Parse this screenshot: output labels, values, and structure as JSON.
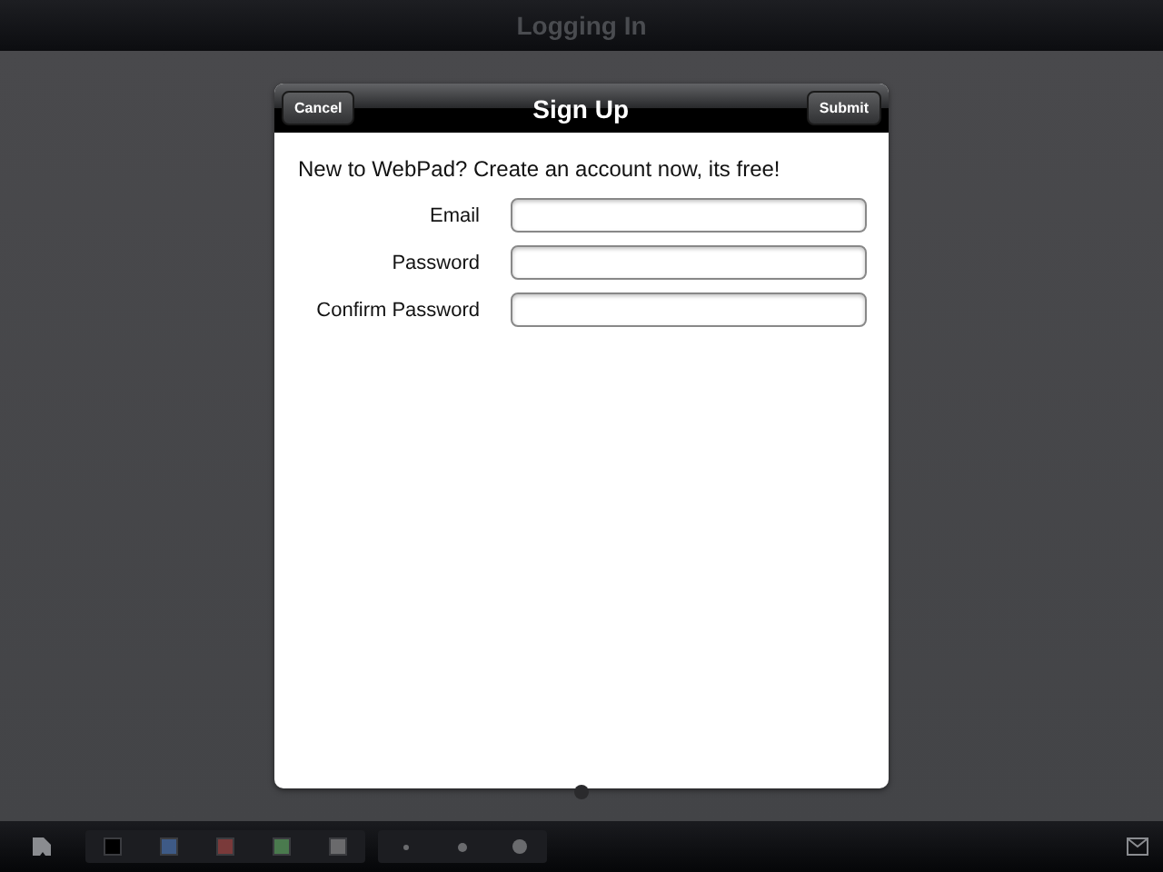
{
  "top_bar": {
    "title": "Logging In"
  },
  "dialog": {
    "title": "Sign Up",
    "cancel_button": "Cancel",
    "submit_button": "Submit",
    "intro": "New to WebPad? Create an account now, its free!",
    "fields": [
      {
        "label": "Email"
      },
      {
        "label": "Password"
      },
      {
        "label": "Confirm Password"
      }
    ]
  },
  "toolbar": {
    "colors": [
      {
        "color": "#000000"
      },
      {
        "color": "#3e5a86"
      },
      {
        "color": "#7a3a3a"
      },
      {
        "color": "#4a7a4e"
      },
      {
        "color": "#6a6a6c"
      }
    ],
    "sizes": [
      {
        "kind": "small"
      },
      {
        "kind": "medium"
      },
      {
        "kind": "large"
      }
    ]
  }
}
